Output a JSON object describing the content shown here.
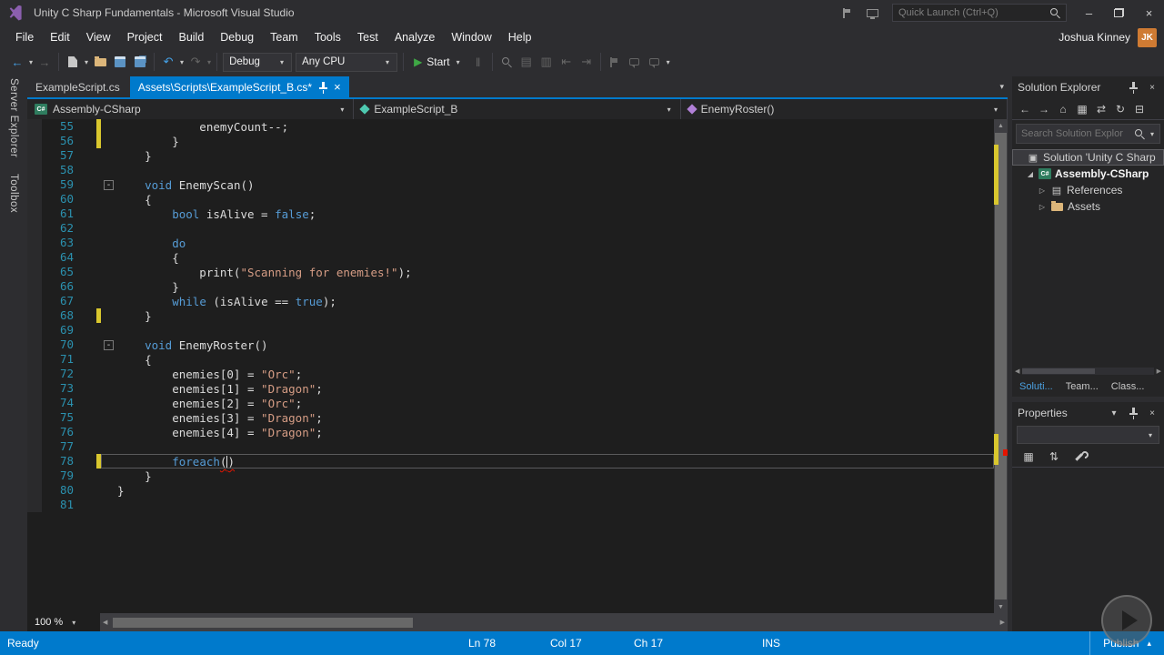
{
  "title_bar": {
    "title": "Unity C Sharp Fundamentals - Microsoft Visual Studio",
    "quick_launch": "Quick Launch (Ctrl+Q)"
  },
  "menu_bar": {
    "items": [
      "File",
      "Edit",
      "View",
      "Project",
      "Build",
      "Debug",
      "Team",
      "Tools",
      "Test",
      "Analyze",
      "Window",
      "Help"
    ],
    "user": "Joshua Kinney",
    "avatar": "JK"
  },
  "toolbar": {
    "debug": "Debug",
    "platform": "Any CPU",
    "start": "Start"
  },
  "side_tabs": {
    "items": [
      "Server Explorer",
      "Toolbox"
    ]
  },
  "doc_tabs": {
    "tabs": [
      {
        "label": "ExampleScript.cs",
        "active": false
      },
      {
        "label": "Assets\\Scripts\\ExampleScript_B.cs*",
        "active": true
      }
    ]
  },
  "nav_bar": {
    "project": "Assembly-CSharp",
    "type": "ExampleScript_B",
    "member": "EnemyRoster()"
  },
  "editor": {
    "zoom": "100 %",
    "cursor_line": 78,
    "lines": [
      {
        "n": 55,
        "c": true,
        "t": [
          [
            "p",
            "            enemyCount--;"
          ]
        ]
      },
      {
        "n": 56,
        "c": true,
        "t": [
          [
            "p",
            "        }"
          ]
        ]
      },
      {
        "n": 57,
        "t": [
          [
            "p",
            "    }"
          ]
        ]
      },
      {
        "n": 58,
        "t": []
      },
      {
        "n": 59,
        "f": true,
        "t": [
          [
            "p",
            "    "
          ],
          [
            "k",
            "void"
          ],
          [
            "p",
            " EnemyScan()"
          ]
        ]
      },
      {
        "n": 60,
        "t": [
          [
            "p",
            "    {"
          ]
        ]
      },
      {
        "n": 61,
        "t": [
          [
            "p",
            "        "
          ],
          [
            "k",
            "bool"
          ],
          [
            "p",
            " isAlive = "
          ],
          [
            "k",
            "false"
          ],
          [
            "p",
            ";"
          ]
        ]
      },
      {
        "n": 62,
        "t": []
      },
      {
        "n": 63,
        "t": [
          [
            "p",
            "        "
          ],
          [
            "k",
            "do"
          ]
        ]
      },
      {
        "n": 64,
        "t": [
          [
            "p",
            "        {"
          ]
        ]
      },
      {
        "n": 65,
        "t": [
          [
            "p",
            "            print("
          ],
          [
            "s",
            "\"Scanning for enemies!\""
          ],
          [
            "p",
            ");"
          ]
        ]
      },
      {
        "n": 66,
        "t": [
          [
            "p",
            "        }"
          ]
        ]
      },
      {
        "n": 67,
        "t": [
          [
            "p",
            "        "
          ],
          [
            "k",
            "while"
          ],
          [
            "p",
            " (isAlive == "
          ],
          [
            "k",
            "true"
          ],
          [
            "p",
            ");"
          ]
        ]
      },
      {
        "n": 68,
        "c": true,
        "t": [
          [
            "p",
            "    }"
          ]
        ]
      },
      {
        "n": 69,
        "t": []
      },
      {
        "n": 70,
        "f": true,
        "t": [
          [
            "p",
            "    "
          ],
          [
            "k",
            "void"
          ],
          [
            "p",
            " EnemyRoster()"
          ]
        ]
      },
      {
        "n": 71,
        "t": [
          [
            "p",
            "    {"
          ]
        ]
      },
      {
        "n": 72,
        "t": [
          [
            "p",
            "        enemies[0] = "
          ],
          [
            "s",
            "\"Orc\""
          ],
          [
            "p",
            ";"
          ]
        ]
      },
      {
        "n": 73,
        "t": [
          [
            "p",
            "        enemies[1] = "
          ],
          [
            "s",
            "\"Dragon\""
          ],
          [
            "p",
            ";"
          ]
        ]
      },
      {
        "n": 74,
        "t": [
          [
            "p",
            "        enemies[2] = "
          ],
          [
            "s",
            "\"Orc\""
          ],
          [
            "p",
            ";"
          ]
        ]
      },
      {
        "n": 75,
        "t": [
          [
            "p",
            "        enemies[3] = "
          ],
          [
            "s",
            "\"Dragon\""
          ],
          [
            "p",
            ";"
          ]
        ]
      },
      {
        "n": 76,
        "t": [
          [
            "p",
            "        enemies[4] = "
          ],
          [
            "s",
            "\"Dragon\""
          ],
          [
            "p",
            ";"
          ]
        ]
      },
      {
        "n": 77,
        "t": []
      },
      {
        "n": 78,
        "c": true,
        "t": [
          [
            "p",
            "        "
          ],
          [
            "k",
            "foreach"
          ],
          [
            "e",
            "("
          ],
          [
            "caret",
            ""
          ],
          [
            "e",
            ")"
          ]
        ]
      },
      {
        "n": 79,
        "t": [
          [
            "p",
            "    }"
          ]
        ]
      },
      {
        "n": 80,
        "t": [
          [
            "p",
            "}"
          ]
        ]
      },
      {
        "n": 81,
        "t": []
      }
    ]
  },
  "solution_explorer": {
    "title": "Solution Explorer",
    "search_placeholder": "Search Solution Explor",
    "toolbar_icons": [
      {
        "name": "back-icon",
        "glyph": "←"
      },
      {
        "name": "forward-icon",
        "glyph": "→"
      },
      {
        "name": "home-icon",
        "glyph": "⌂"
      },
      {
        "name": "show-all-files-icon",
        "glyph": "▦"
      },
      {
        "name": "sync-with-active-document-icon",
        "glyph": "⇄"
      },
      {
        "name": "refresh-icon",
        "glyph": "↻"
      },
      {
        "name": "collapse-all-icon",
        "glyph": "⊟"
      }
    ],
    "tree": [
      {
        "label": "Solution 'Unity C Sharp",
        "level": 0,
        "expand": "none",
        "icon": "solution",
        "selected": true
      },
      {
        "label": "Assembly-CSharp",
        "level": 1,
        "expand": "open",
        "icon": "csproj",
        "bold": true
      },
      {
        "label": "References",
        "level": 2,
        "expand": "closed",
        "icon": "references"
      },
      {
        "label": "Assets",
        "level": 2,
        "expand": "closed",
        "icon": "folder"
      }
    ],
    "bottom_tabs": [
      {
        "label": "Soluti...",
        "active": true
      },
      {
        "label": "Team...",
        "active": false
      },
      {
        "label": "Class...",
        "active": false
      }
    ]
  },
  "properties": {
    "title": "Properties",
    "toolbar_icons": [
      {
        "name": "categorized-icon",
        "glyph": "▦"
      },
      {
        "name": "alphabetical-icon",
        "glyph": "⇅"
      },
      {
        "name": "property-pages-icon",
        "glyph": ""
      }
    ]
  },
  "status_bar": {
    "ready": "Ready",
    "ln": "Ln 78",
    "col": "Col 17",
    "ch": "Ch 17",
    "ins": "INS",
    "publish": "Publish"
  },
  "icons": {
    "dropdown": "▾",
    "back": "←",
    "forward": "→",
    "undo": "↶",
    "redo": "↷",
    "play": "▶",
    "pause": "‖",
    "window_split": "▤",
    "window": "▥",
    "indent_dec": "⇤",
    "indent_inc": "⇥",
    "overflow": "▾",
    "minimize": "–",
    "close": "×",
    "tree_open": "◢",
    "tree_closed": "▷",
    "solution": "▣",
    "references": "▤",
    "csharp_label": "C#",
    "scroll_up": "▲",
    "scroll_down": "▼",
    "scroll_left": "◀",
    "scroll_right": "▶",
    "publish_chevron": "▴",
    "fold_collapse": "-"
  }
}
